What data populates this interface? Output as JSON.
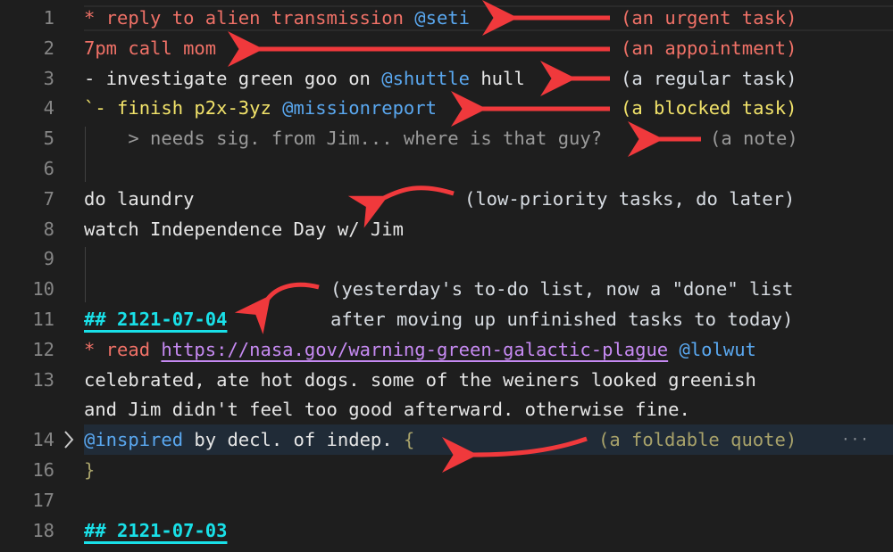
{
  "editor": {
    "lines": [
      {
        "number": "1",
        "segments": [
          {
            "text": "* reply to alien transmission ",
            "style": "red"
          },
          {
            "text": "@seti",
            "style": "blue"
          }
        ],
        "annotation": "(an urgent task)",
        "annotation_style": "red"
      },
      {
        "number": "2",
        "segments": [
          {
            "text": "7pm call mom",
            "style": "red"
          }
        ],
        "annotation": "(an appointment)",
        "annotation_style": "red"
      },
      {
        "number": "3",
        "segments": [
          {
            "text": "- investigate green goo on ",
            "style": "white"
          },
          {
            "text": "@shuttle",
            "style": "blue"
          },
          {
            "text": " hull",
            "style": "white"
          }
        ],
        "annotation": "(a regular task)",
        "annotation_style": "light"
      },
      {
        "number": "4",
        "segments": [
          {
            "text": "`- finish p2x-3yz ",
            "style": "yellow"
          },
          {
            "text": "@missionreport",
            "style": "blue"
          }
        ],
        "annotation": "(a blocked task)",
        "annotation_style": "yellow"
      },
      {
        "number": "5",
        "segments": [
          {
            "text": "    > needs sig. from Jim... where is that guy?",
            "style": "grey"
          }
        ],
        "annotation": "(a note)",
        "annotation_style": "grey"
      },
      {
        "number": "6",
        "segments": []
      },
      {
        "number": "7",
        "segments": [
          {
            "text": "do laundry",
            "style": "white"
          }
        ],
        "annotation": "(low-priority tasks, do later)",
        "annotation_style": "light"
      },
      {
        "number": "8",
        "segments": [
          {
            "text": "watch Independence Day w/ Jim",
            "style": "white"
          }
        ]
      },
      {
        "number": "9",
        "segments": []
      },
      {
        "number": "10",
        "segments": [],
        "annotation": "(yesterday's to-do list, now a \"done\" list",
        "annotation_style": "light"
      },
      {
        "number": "11",
        "segments": [
          {
            "text": "## 2121-07-04",
            "style": "cyan"
          }
        ],
        "annotation": "after moving up unfinished tasks to today)",
        "annotation_style": "light"
      },
      {
        "number": "12",
        "segments": [
          {
            "text": "* read ",
            "style": "red"
          },
          {
            "text": "https://nasa.gov/warning-green-galactic-plague",
            "style": "link"
          },
          {
            "text": " ",
            "style": "white"
          },
          {
            "text": "@lolwut",
            "style": "blue"
          }
        ]
      },
      {
        "number": "13",
        "segments": [
          {
            "text": "celebrated, ate hot dogs. some of the weiners looked greenish",
            "style": "white"
          }
        ]
      },
      {
        "number": "",
        "segments": [
          {
            "text": "and Jim didn't feel too good afterward. otherwise fine.",
            "style": "white"
          }
        ]
      },
      {
        "number": "14",
        "segments": [
          {
            "text": "@inspired",
            "style": "blue"
          },
          {
            "text": " by decl. of indep. ",
            "style": "white"
          },
          {
            "text": "{",
            "style": "olive"
          }
        ],
        "annotation": "(a foldable quote)",
        "annotation_style": "olive",
        "folded": true,
        "fold_icon": "chevron-right-icon",
        "fold_ellipsis": "···"
      },
      {
        "number": "16",
        "segments": [
          {
            "text": "}",
            "style": "olive"
          }
        ]
      },
      {
        "number": "17",
        "segments": []
      },
      {
        "number": "18",
        "segments": [
          {
            "text": "## 2121-07-03",
            "style": "cyan"
          }
        ]
      }
    ],
    "colors": {
      "background": "#1e1e1e",
      "urgent": "#f07167",
      "mention": "#5aa8f0",
      "blocked": "#f2e36a",
      "note": "#9a9a9a",
      "heading": "#19e0e8",
      "link": "#c68af2",
      "quote": "#a8a26a",
      "arrow": "#f0393c",
      "folded_line_bg": "#202b37"
    }
  }
}
